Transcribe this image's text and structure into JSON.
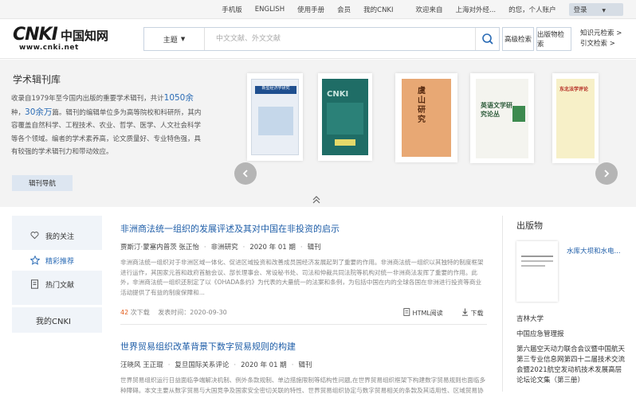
{
  "topbar": {
    "links": [
      "手机版",
      "ENGLISH",
      "使用手册",
      "会员",
      "我的CNKI"
    ],
    "welcome": "欢迎来自",
    "org": "上海对外经...",
    "personal": "的您，个人账户",
    "login": "登录"
  },
  "header": {
    "logo_text": "CNKI",
    "logo_cn": "中国知网",
    "logo_url": "www.cnki.net",
    "search_field": "主题",
    "search_placeholder": "中文文献、外文文献",
    "advanced_search": "高级检索",
    "publication_search": "出版物检索",
    "knowledge_element_search": "知识元检索 >",
    "citation_search": "引文检索 >"
  },
  "banner": {
    "title": "学术辑刊库",
    "desc_1": "收录自1979年至今国内出版的重要学术辑刊，共计",
    "count_journals": "1050余",
    "desc_2": "种，",
    "count_articles": "30余万",
    "desc_3": "篇。辑刊的编辑单位多为高等院校和科研所，其内容覆盖自然科学、工程技术、农业、哲学、医学、人文社会科学等各个领域。编者的学术素养高，论文质量好、专业特色强，具有较强的学术辑刊力和带动效应。",
    "nav_button": "辑刊导航",
    "books": [
      {
        "title": "新型经济学研究"
      },
      {
        "title": "CNKI"
      },
      {
        "title": "虞山研究"
      },
      {
        "title": "英语文学研究论丛"
      },
      {
        "title": "东北法学评论"
      }
    ]
  },
  "left_nav": {
    "items": [
      {
        "label": "我的关注",
        "icon": "heart-icon"
      },
      {
        "label": "精彩推荐",
        "icon": "star-icon"
      },
      {
        "label": "热门文献",
        "icon": "document-icon"
      }
    ],
    "my_cnki": "我的CNKI"
  },
  "articles": [
    {
      "title": "非洲商法统一组织的发展评述及其对中国在非投资的启示",
      "authors": "贾斯汀·蒙塞内普茨 张正怡",
      "journal": "非洲研究",
      "issue": "2020 年 01 期",
      "category": "辑刊",
      "abstract": "非洲商法统一组织对于非洲区域一体化、促进区域投资和改善成员国经济发展起到了重要的作用。非洲商法统一组织以其独特的制度框架进行运作，其国家元首和政府首脑会议、部长理事会、常设秘书处、司法和仲裁共同法院等机构对统一非洲商法发挥了重要的作用。此外，非洲商法统一组织还制定了以《OHADA条约》为代表的大量统一的法案和条例，为包括中国在内的全球各国在非洲进行投资等商业活动提供了有益的制度保障和...",
      "downloads": "42",
      "downloads_label": "次下载",
      "publish_date": "发表时间：2020-09-30",
      "html_read": "HTML阅读",
      "download": "下载"
    },
    {
      "title": "世界贸易组织改革背景下数字贸易规则的构建",
      "authors": "汪晓风 王正琨",
      "journal": "复旦国际关系评论",
      "issue": "2020 年 01 期",
      "category": "辑刊",
      "abstract": "世界贸易组织运行日益面临争端解决机制、例外条款规制、单边措施限制等结构性问题,在世界贸易组织框架下构建数字贸易规则也面临多种障碍。本文主要从数字贸易与大国竞争及国家安全密切关联的特性、世界贸易组织协定与数字贸易相关的条款及其适用性、区域贸易协"
    }
  ],
  "right_panel": {
    "title": "出版物",
    "featured": "水库大坝和水电...",
    "publishers": [
      "吉林大学",
      "中国应急管理报",
      "第六届空天动力联合会议暨中国航天第三专业信息网第四十二届技术交流会暨2021航空发动机技术发展高层论坛论文集（第三册）"
    ]
  }
}
